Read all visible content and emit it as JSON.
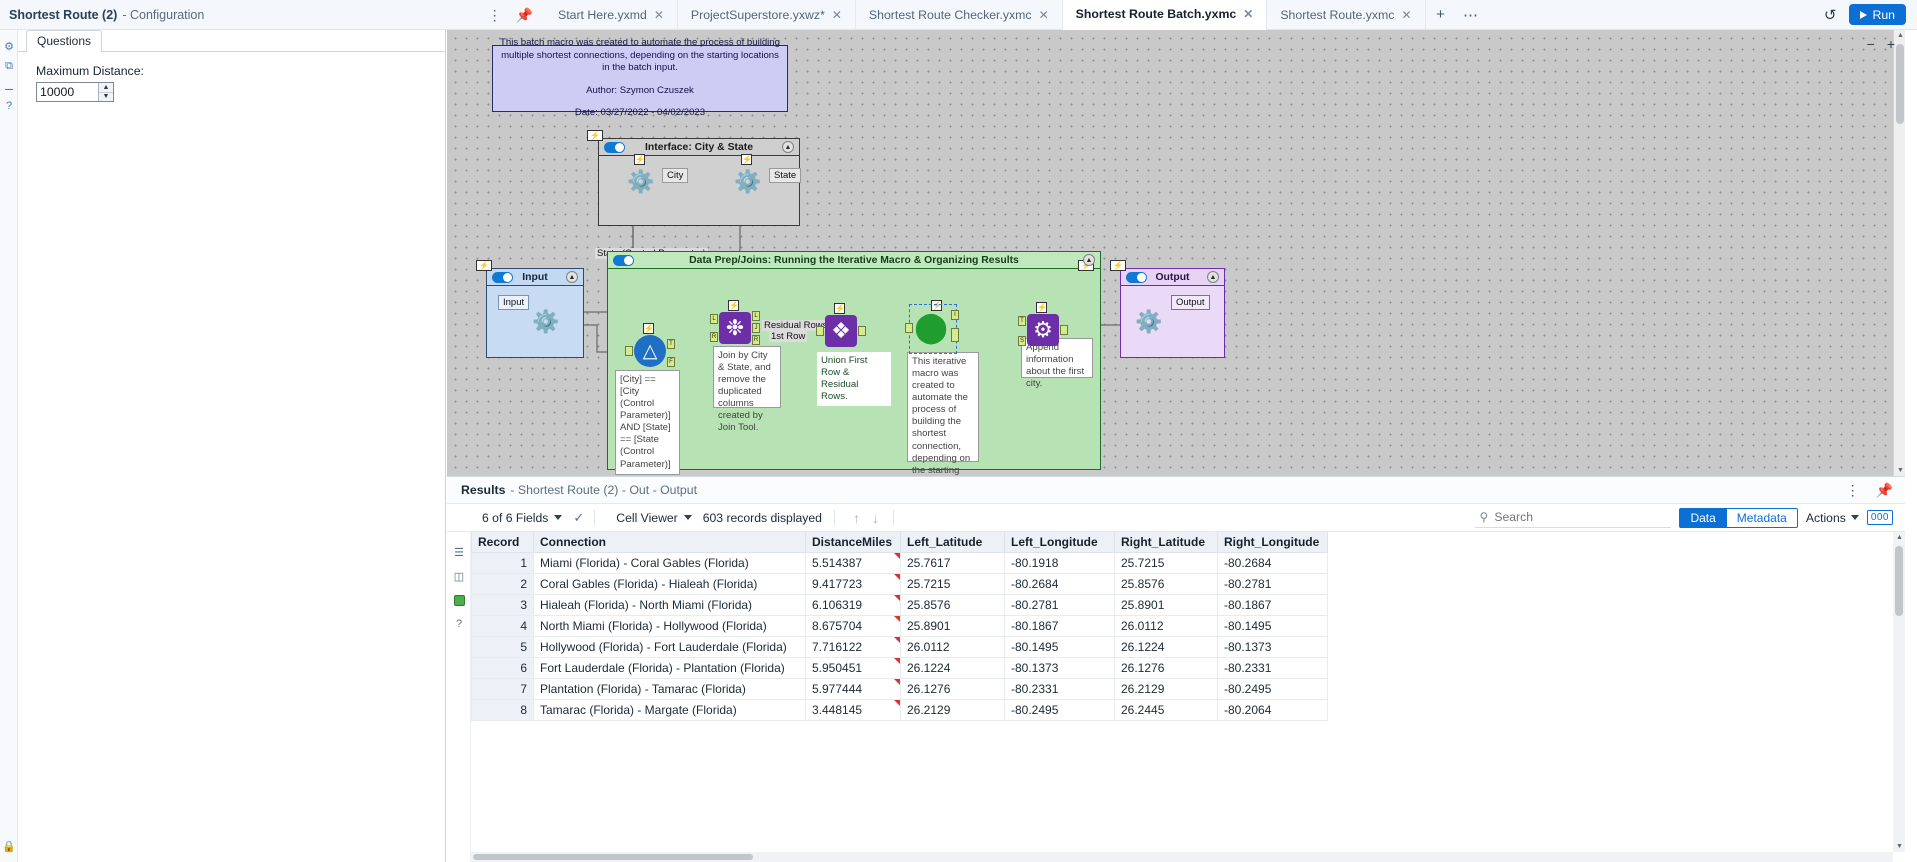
{
  "config_header": {
    "title": "Shortest Route (2)",
    "subtitle": "- Configuration",
    "menu_icon": "kebab-menu-icon",
    "pin_icon": "pin-icon"
  },
  "tabs": [
    {
      "label": "Start Here.yxmd",
      "active": false
    },
    {
      "label": "ProjectSuperstore.yxwz*",
      "active": false
    },
    {
      "label": "Shortest Route Checker.yxmc",
      "active": false
    },
    {
      "label": "Shortest Route Batch.yxmc",
      "active": true
    },
    {
      "label": "Shortest Route.yxmc",
      "active": false
    }
  ],
  "tab_controls": {
    "new_tab": "+",
    "more": "⋯"
  },
  "top_right": {
    "history_icon": "history-clock-icon",
    "run_label": "Run"
  },
  "rail_icons": [
    "gear-icon",
    "share-icon",
    "tag-icon",
    "help-icon",
    "lock-icon"
  ],
  "config_panel": {
    "tab_label": "Questions",
    "field_label": "Maximum Distance:",
    "field_value": "10000"
  },
  "canvas": {
    "zoom_out": "−",
    "zoom_in": "+",
    "comment": {
      "line1": "This batch macro was created to automate the process of building multiple shortest connections, depending on the starting locations in the batch input.",
      "line2": "Author: Szymon Czuszek",
      "line3": "Date: 03/27/2022 - 04/02/2023"
    },
    "containers": [
      {
        "name": "interface",
        "title": "Interface: City & State"
      },
      {
        "name": "input",
        "title": "Input"
      },
      {
        "name": "dataprep",
        "title": "Data Prep/Joins: Running the Iterative Macro & Organizing Results"
      },
      {
        "name": "output",
        "title": "Output"
      }
    ],
    "labels": {
      "city": "City",
      "state": "State",
      "input_tool": "Input",
      "output_tool": "Output",
      "state_control_param": "State (Control Parameter)",
      "residual_rows": "Residual Rows",
      "first_row": "1st Row"
    },
    "annotations": [
      "[City] == [City (Control Parameter)] AND [State] == [State (Control Parameter)]",
      "Join by City & State, and remove the duplicated columns created by Join Tool.",
      "Union First Row & Residual Rows.",
      "This iterative macro was created to automate the process of building the shortest connection, depending on the starting location.",
      "Append information about the first city."
    ]
  },
  "results": {
    "title": "Results",
    "subtitle": "- Shortest Route (2) - Out - Output",
    "header_icons": [
      "kebab-menu-icon",
      "pin-icon"
    ],
    "toolbar": {
      "fields": "6 of 6 Fields",
      "viewer": "Cell Viewer",
      "records": "603 records displayed",
      "search_placeholder": "Search",
      "search_value": "",
      "data_label": "Data",
      "metadata_label": "Metadata",
      "actions_label": "Actions",
      "count_badge": "000"
    },
    "columns": [
      "Record",
      "Connection",
      "DistanceMiles",
      "Left_Latitude",
      "Left_Longitude",
      "Right_Latitude",
      "Right_Longitude"
    ],
    "rows": [
      [
        "1",
        "Miami (Florida) - Coral Gables (Florida)",
        "5.514387",
        "25.7617",
        "-80.1918",
        "25.7215",
        "-80.2684"
      ],
      [
        "2",
        "Coral Gables (Florida) - Hialeah (Florida)",
        "9.417723",
        "25.7215",
        "-80.2684",
        "25.8576",
        "-80.2781"
      ],
      [
        "3",
        "Hialeah (Florida) - North Miami (Florida)",
        "6.106319",
        "25.8576",
        "-80.2781",
        "25.8901",
        "-80.1867"
      ],
      [
        "4",
        "North Miami (Florida) - Hollywood (Florida)",
        "8.675704",
        "25.8901",
        "-80.1867",
        "26.0112",
        "-80.1495"
      ],
      [
        "5",
        "Hollywood (Florida) - Fort Lauderdale (Florida)",
        "7.716122",
        "26.0112",
        "-80.1495",
        "26.1224",
        "-80.1373"
      ],
      [
        "6",
        "Fort Lauderdale (Florida) - Plantation (Florida)",
        "5.950451",
        "26.1224",
        "-80.1373",
        "26.1276",
        "-80.2331"
      ],
      [
        "7",
        "Plantation (Florida) - Tamarac (Florida)",
        "5.977444",
        "26.1276",
        "-80.2331",
        "26.2129",
        "-80.2495"
      ],
      [
        "8",
        "Tamarac (Florida) - Margate (Florida)",
        "3.448145",
        "26.2129",
        "-80.2495",
        "26.2445",
        "-80.2064"
      ]
    ]
  }
}
